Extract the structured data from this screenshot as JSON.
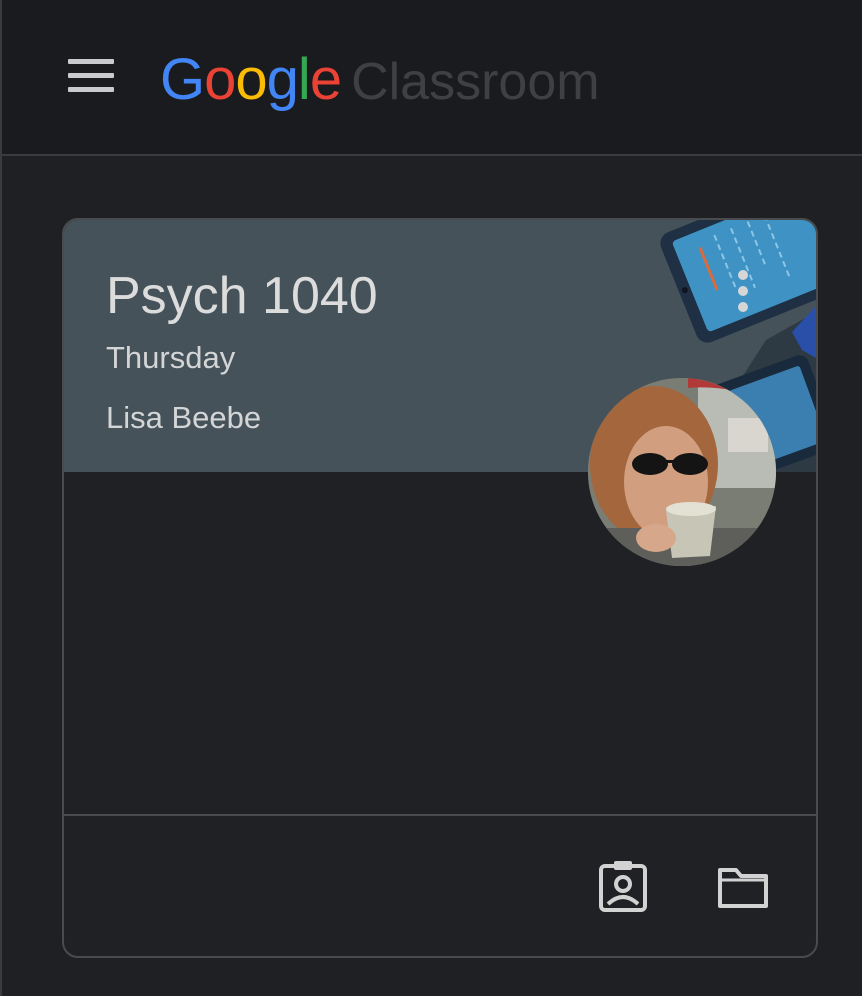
{
  "app": {
    "logo_google": [
      "G",
      "o",
      "o",
      "g",
      "l",
      "e"
    ],
    "logo_colors": [
      "#4285F4",
      "#EA4335",
      "#FBBC05",
      "#4285F4",
      "#34A853",
      "#EA4335"
    ],
    "product_name": "Classroom"
  },
  "card": {
    "title": "Psych 1040",
    "section": "Thursday",
    "teacher": "Lisa Beebe",
    "header_color": "#45525a",
    "icons": {
      "more": "more-vert-icon",
      "work": "your-work-icon",
      "folder": "folder-icon"
    }
  }
}
